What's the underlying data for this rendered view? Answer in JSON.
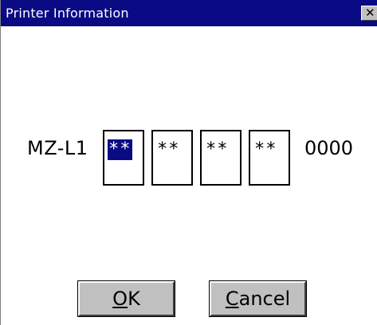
{
  "window": {
    "title": "Printer Information",
    "close_glyph": "✕"
  },
  "printer": {
    "model": "MZ-L1",
    "segments": [
      "**",
      "**",
      "**",
      "**"
    ],
    "suffix": "0000"
  },
  "buttons": {
    "ok": {
      "mnemonic": "O",
      "rest": "K"
    },
    "cancel": {
      "mnemonic": "C",
      "rest": "ancel"
    }
  },
  "colors": {
    "titlebar": "#0a0a84",
    "selection": "#0a0a84",
    "button_face": "#c0c0c0"
  }
}
